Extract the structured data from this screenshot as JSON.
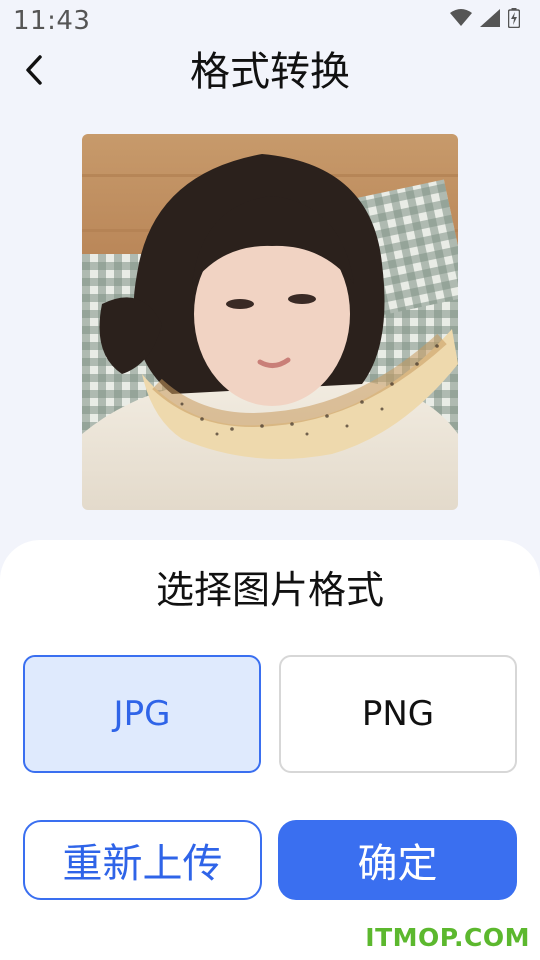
{
  "status_bar": {
    "time": "11:43",
    "icons": [
      "wifi-icon",
      "cellular-signal-icon",
      "battery-icon"
    ]
  },
  "app_bar": {
    "title": "格式转换",
    "back_icon": "chevron-left-icon"
  },
  "preview": {
    "image": "photo of a girl lying on a pillow with a bread ring around her neck"
  },
  "sheet": {
    "title": "选择图片格式",
    "formats": [
      {
        "label": "JPG",
        "selected": true
      },
      {
        "label": "PNG",
        "selected": false
      }
    ],
    "reupload_label": "重新上传",
    "confirm_label": "确定"
  },
  "watermark": "ITMOP.COM",
  "colors": {
    "accent": "#3a6ff0",
    "selected_bg": "#dfeafd",
    "page_bg": "#f2f4fb",
    "watermark": "#5cb82e"
  }
}
